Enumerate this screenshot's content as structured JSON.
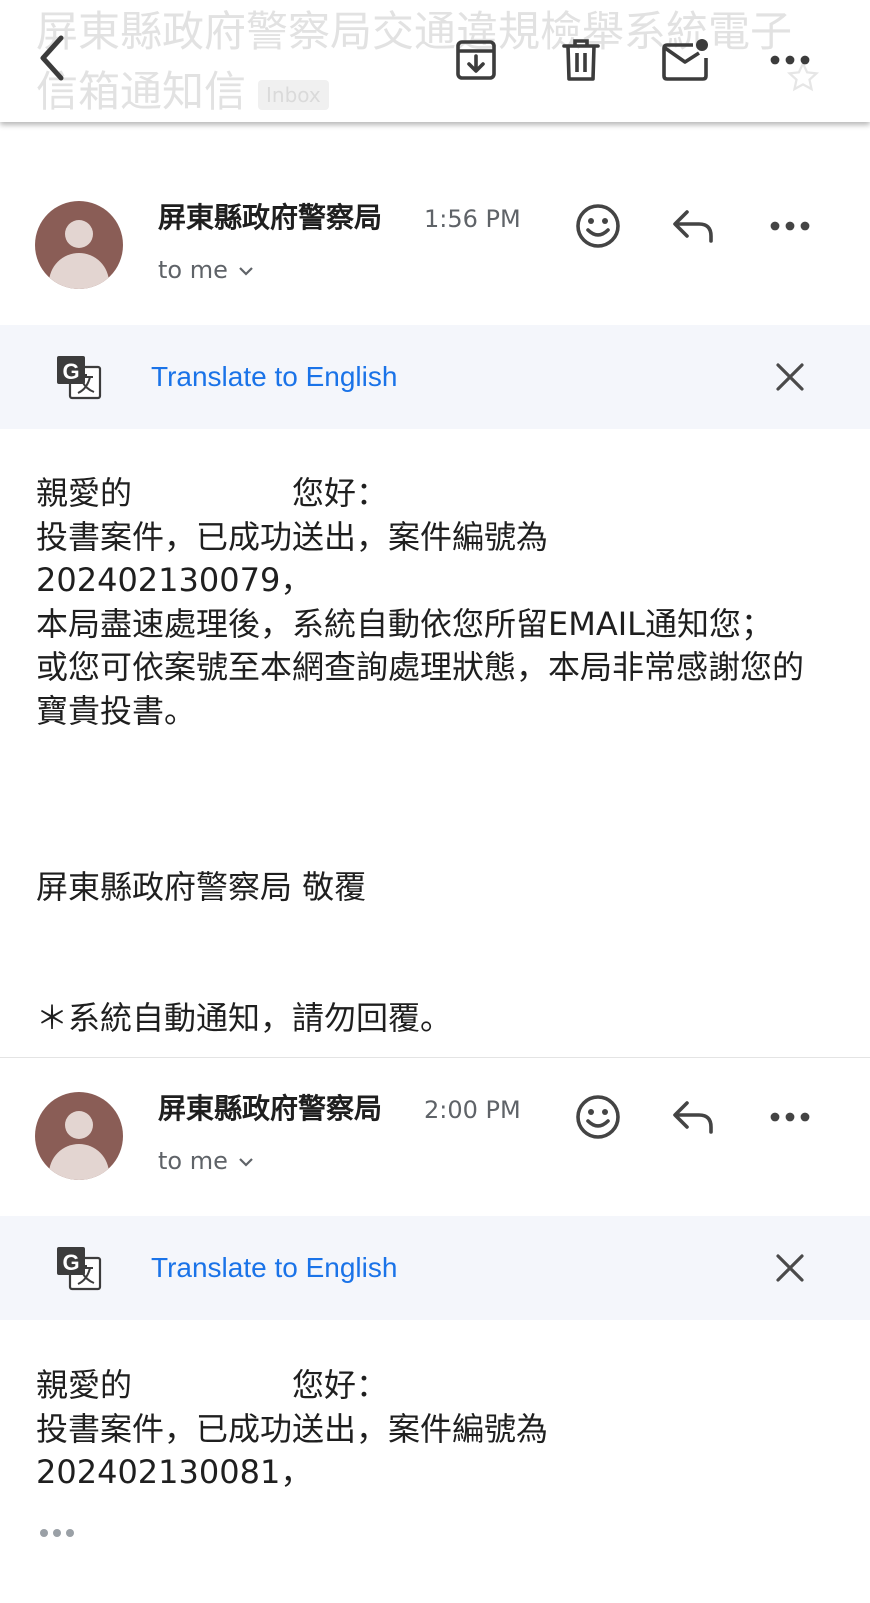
{
  "toolbar": {
    "subject": "屏東縣政府警察局交通違規檢舉系統電子信箱通知信",
    "label_badge": "Inbox"
  },
  "messages": [
    {
      "sender": "屏東縣政府警察局",
      "time": "1:56 PM",
      "recipient": "to me",
      "translate_label": "Translate to English",
      "greeting": "親愛的　　　　　您好：",
      "line1": "投書案件，已成功送出，案件編號為",
      "case_number": "202402130079，",
      "line3": "本局盡速處理後，系統自動依您所留EMAIL通知您；",
      "line4": "或您可依案號至本網查詢處理狀態，本局非常感謝您的寶貴投書。",
      "signature": "屏東縣政府警察局 敬覆",
      "footer": "＊系統自動通知，請勿回覆。"
    },
    {
      "sender": "屏東縣政府警察局",
      "time": "2:00 PM",
      "recipient": "to me",
      "translate_label": "Translate to English",
      "greeting": "親愛的　　　　　您好：",
      "line1": "投書案件，已成功送出，案件編號為",
      "case_number": "202402130081，"
    }
  ]
}
